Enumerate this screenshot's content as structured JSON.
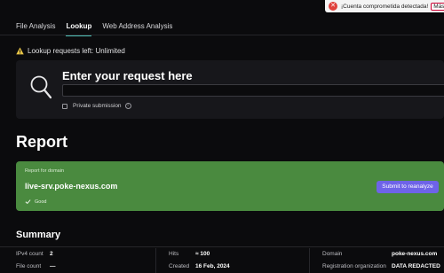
{
  "toast": {
    "text": "¡Cuenta comprometida detectada!",
    "button": "Más"
  },
  "tabs": [
    {
      "label": "File Analysis",
      "active": false
    },
    {
      "label": "Lookup",
      "active": true
    },
    {
      "label": "Web Address Analysis",
      "active": false
    }
  ],
  "lookup_limit": "Lookup requests left: Unlimited",
  "search": {
    "title": "Enter your request here",
    "value": "",
    "private_label": "Private submission"
  },
  "report": {
    "heading": "Report",
    "subtitle": "Report for domain",
    "domain": "live-srv.poke-nexus.com",
    "status": "Good",
    "status_color": "#4a8a3f",
    "reanalyze_label": "Submit to reanalyze"
  },
  "summary": {
    "heading": "Summary",
    "items": [
      {
        "key": "IPv4 count",
        "value": "2"
      },
      {
        "key": "File count",
        "value": "—"
      },
      {
        "key": "Hits",
        "value": "≈ 100"
      },
      {
        "key": "Created",
        "value": "16 Feb, 2024"
      },
      {
        "key": "Domain",
        "value": "poke-nexus.com"
      },
      {
        "key": "Registration organization",
        "value": "DATA REDACTED"
      }
    ]
  },
  "colors": {
    "accent_tab": "#4fc1b8",
    "button": "#6e63e8",
    "warning": "#e8c547"
  }
}
